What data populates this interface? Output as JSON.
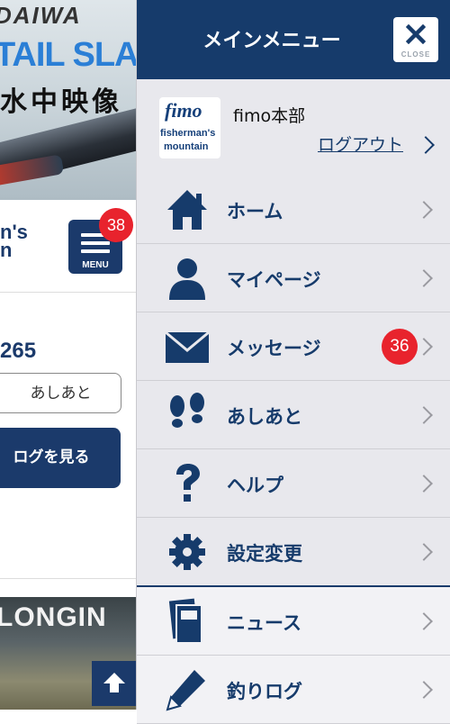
{
  "background_page": {
    "banner_brand": "DAIWA",
    "banner_title": "TAIL SLAP",
    "banner_subtitle": "水中映像",
    "logo_text": "n's\nn",
    "menu_button_label": "MENU",
    "menu_badge": "38",
    "count": "265",
    "ashiato_button": "あしあと",
    "view_log_button": "ログを見る",
    "banner2_text": "LONGIN"
  },
  "drawer": {
    "title": "メインメニュー",
    "close_label": "CLOSE",
    "user": {
      "avatar_text": [
        "fimo",
        "fisherman's",
        "mountain"
      ],
      "name": "fimo本部",
      "logout_label": "ログアウト"
    },
    "items": [
      {
        "label": "ホーム",
        "icon": "home-icon"
      },
      {
        "label": "マイページ",
        "icon": "person-icon"
      },
      {
        "label": "メッセージ",
        "icon": "envelope-icon",
        "badge": "36"
      },
      {
        "label": "あしあと",
        "icon": "footprints-icon"
      },
      {
        "label": "ヘルプ",
        "icon": "question-icon"
      },
      {
        "label": "設定変更",
        "icon": "gear-icon"
      },
      {
        "label": "ニュース",
        "icon": "newspaper-icon"
      },
      {
        "label": "釣りログ",
        "icon": "pencil-icon"
      }
    ]
  },
  "colors": {
    "navy": "#163b6b",
    "badge_red": "#e8232d",
    "drawer_bg": "#e8e8ed"
  }
}
